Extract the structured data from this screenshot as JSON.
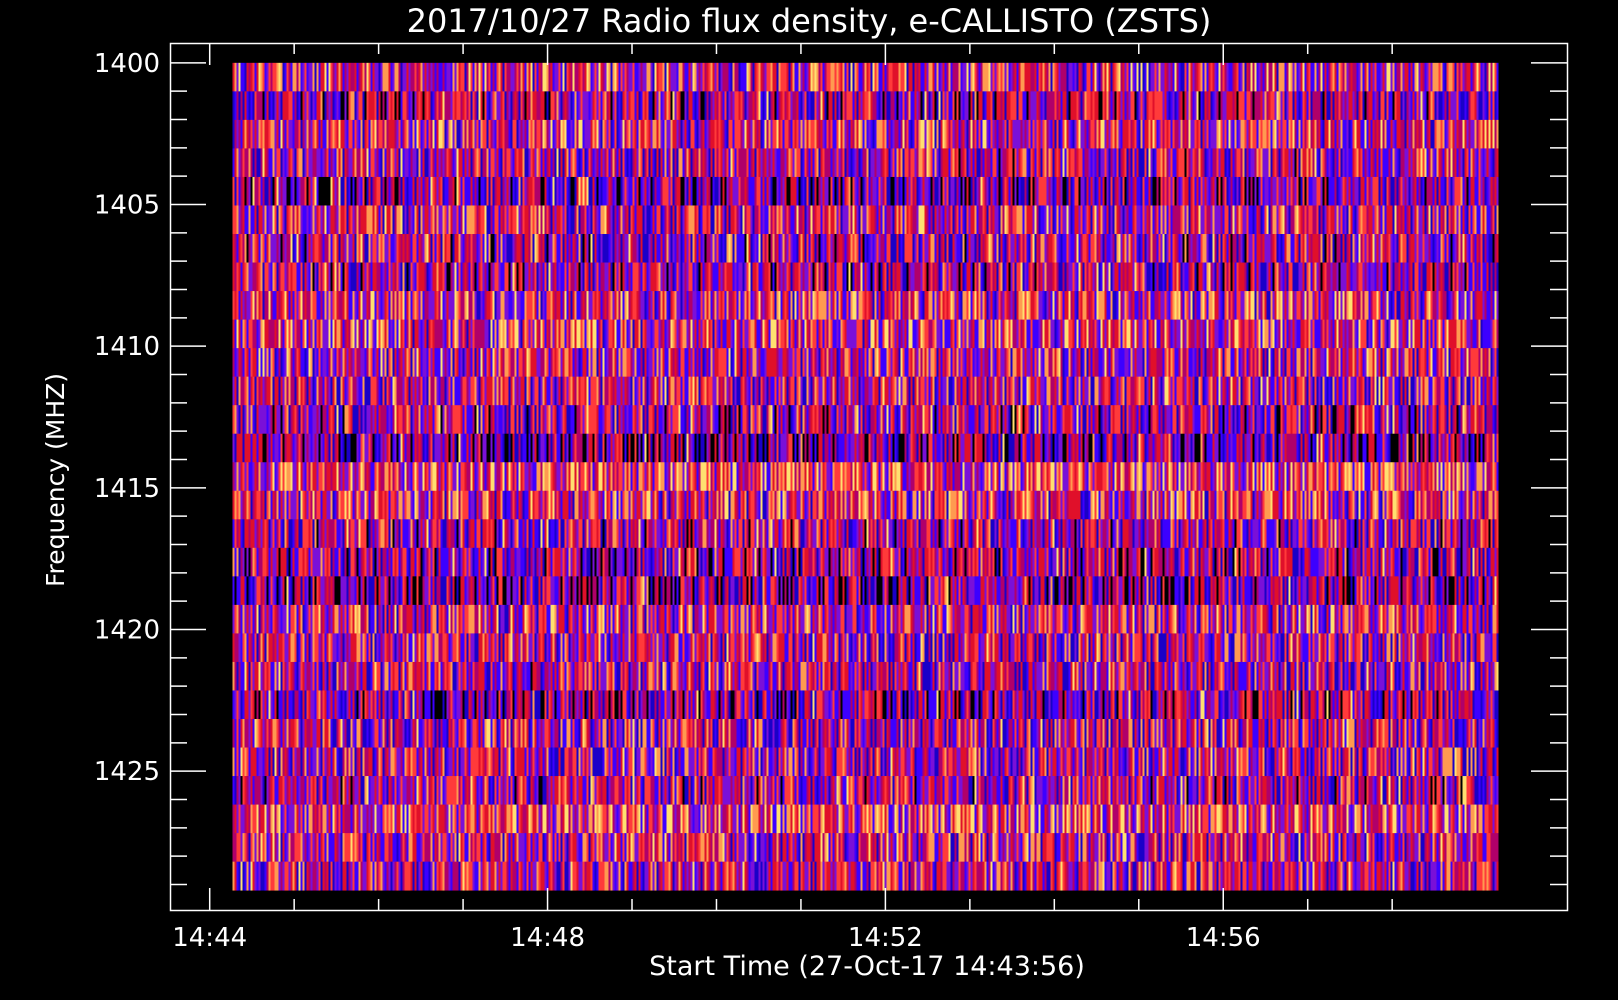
{
  "chart_data": {
    "type": "heatmap",
    "title": "2017/10/27  Radio flux density, e-CALLISTO (ZSTS)",
    "xlabel": "Start Time (27-Oct-17 14:43:56)",
    "ylabel": "Frequency (MHZ)",
    "x_tick_labels": [
      "14:44",
      "14:48",
      "14:52",
      "14:56"
    ],
    "x_major_ticks_min": [
      0,
      4,
      8,
      12
    ],
    "x_minor_ticks_min": [
      1,
      2,
      3,
      5,
      6,
      7,
      9,
      10,
      11,
      13,
      14
    ],
    "xlim_min": [
      -0.47,
      16.07
    ],
    "data_xlim_min": [
      0.27,
      15.27
    ],
    "y_tick_labels": [
      "1400",
      "1405",
      "1410",
      "1415",
      "1420",
      "1425"
    ],
    "y_major_ticks": [
      1400,
      1405,
      1410,
      1415,
      1420,
      1425
    ],
    "y_minor_step": 1,
    "ylim": [
      1399.3,
      1429.9
    ],
    "data_ylim": [
      1400,
      1429.2
    ],
    "y_inverted": true,
    "colors": {
      "background": "#000000",
      "axes": "#ffffff",
      "colormap": [
        "#000000",
        "#1a00c8",
        "#3c00ff",
        "#7a10d8",
        "#b0006a",
        "#e0102a",
        "#ff3a3a",
        "#ff9a50",
        "#ffe070"
      ]
    },
    "row_count": 29,
    "row_mean_intensity": [
      0.55,
      0.42,
      0.55,
      0.48,
      0.38,
      0.52,
      0.46,
      0.42,
      0.55,
      0.58,
      0.54,
      0.5,
      0.44,
      0.35,
      0.62,
      0.55,
      0.45,
      0.42,
      0.36,
      0.55,
      0.5,
      0.48,
      0.4,
      0.5,
      0.5,
      0.45,
      0.62,
      0.52,
      0.5,
      0.42
    ]
  }
}
